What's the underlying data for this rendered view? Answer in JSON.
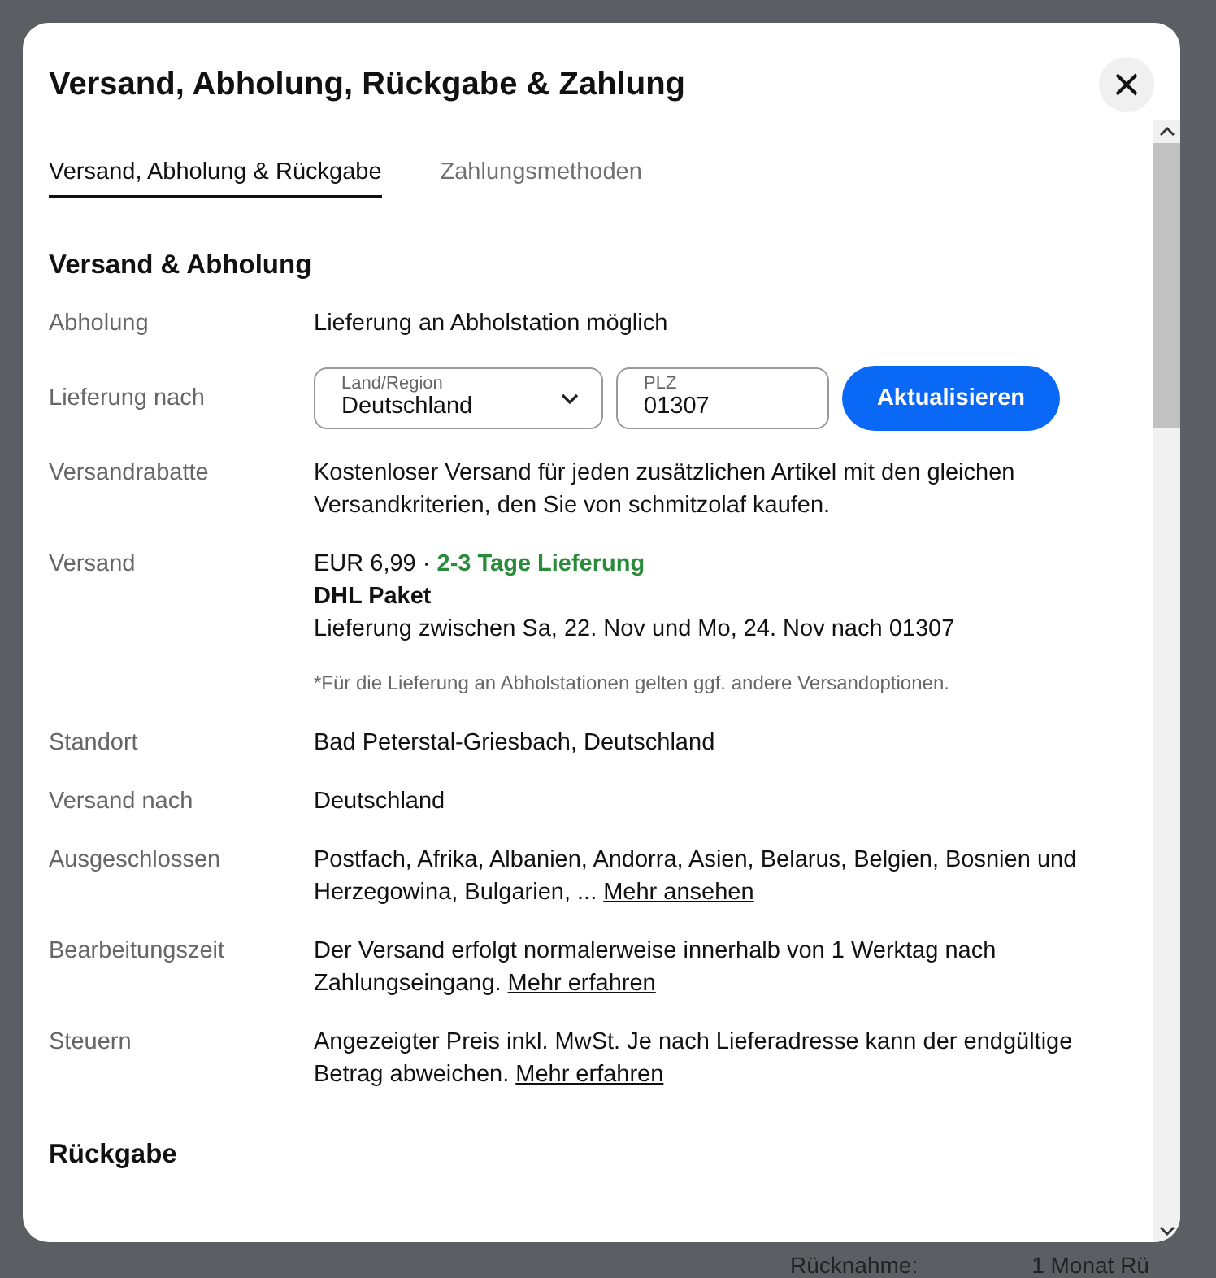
{
  "dialog": {
    "title": "Versand, Abholung, Rückgabe & Zahlung"
  },
  "tabs": [
    {
      "label": "Versand, Abholung & Rückgabe",
      "selected": true
    },
    {
      "label": "Zahlungsmethoden",
      "selected": false
    }
  ],
  "section": {
    "heading": "Versand & Abholung"
  },
  "rows": [
    {
      "kind": "text",
      "label": "Abholung",
      "text": "Lieferung an Abholstation möglich"
    },
    {
      "kind": "location",
      "label": "Lieferung nach",
      "country_label": "Land/Region",
      "country": "Deutschland",
      "zip_label": "PLZ",
      "zip": "01307",
      "button": "Aktualisieren"
    },
    {
      "kind": "text",
      "label": "Versandrabatte",
      "text": "Kostenloser Versand für jeden zusätzlichen Artikel mit den gleichen Versandkriterien, den Sie von schmitzolaf kaufen."
    },
    {
      "kind": "shipping",
      "label": "Versand",
      "price": "EUR 6,99 · ",
      "speed": "2-3 Tage Lieferung",
      "service": "DHL Paket",
      "delivery": "Lieferung zwischen Sa, 22. Nov und Mo, 24. Nov nach 01307",
      "note": "*Für die Lieferung an Abholstationen gelten ggf. andere Versandoptionen."
    },
    {
      "kind": "text",
      "label": "Standort",
      "text": "Bad Peterstal-Griesbach, Deutschland"
    },
    {
      "kind": "text",
      "label": "Versand nach",
      "text": "Deutschland"
    },
    {
      "kind": "text",
      "label": "Ausgeschlossen",
      "text": "Postfach, Afrika, Albanien, Andorra, Asien, Belarus, Belgien, Bosnien und Herzegowina, Bulgarien, ...",
      "link": "Mehr ansehen"
    },
    {
      "kind": "text",
      "label": "Bearbeitungszeit",
      "text": "Der Versand erfolgt normalerweise innerhalb von 1 Werktag nach Zahlungseingang.",
      "link": "Mehr erfahren"
    },
    {
      "kind": "text",
      "label": "Steuern",
      "text": "Angezeigter Preis inkl. MwSt. Je nach Lieferadresse kann der endgültige Betrag abweichen.",
      "link": "Mehr erfahren"
    }
  ],
  "next_section": {
    "heading": "Rückgabe"
  },
  "background": {
    "label": "Rücknahme:",
    "value": "1 Monat Rü"
  }
}
